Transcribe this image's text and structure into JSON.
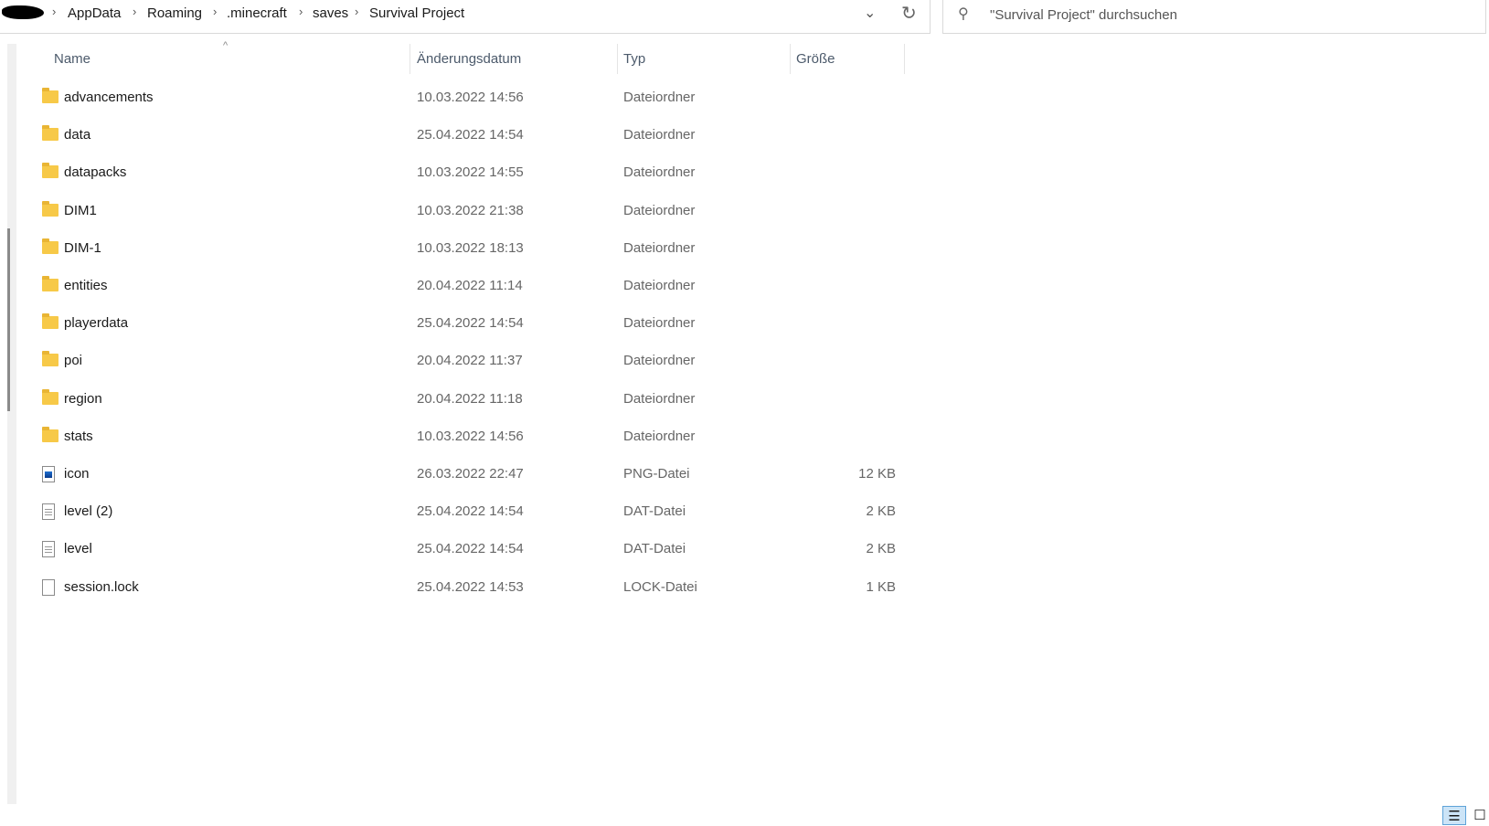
{
  "breadcrumb": [
    "AppData",
    "Roaming",
    ".minecraft",
    "saves",
    "Survival Project"
  ],
  "search": {
    "placeholder": "\"Survival Project\" durchsuchen"
  },
  "columns": {
    "name": "Name",
    "date": "Änderungsdatum",
    "type": "Typ",
    "size": "Größe"
  },
  "rows": [
    {
      "name": "advancements",
      "date": "10.03.2022 14:56",
      "type": "Dateiordner",
      "size": "",
      "icon": "folder-icon"
    },
    {
      "name": "data",
      "date": "25.04.2022 14:54",
      "type": "Dateiordner",
      "size": "",
      "icon": "folder-icon"
    },
    {
      "name": "datapacks",
      "date": "10.03.2022 14:55",
      "type": "Dateiordner",
      "size": "",
      "icon": "folder-icon"
    },
    {
      "name": "DIM1",
      "date": "10.03.2022 21:38",
      "type": "Dateiordner",
      "size": "",
      "icon": "folder-icon"
    },
    {
      "name": "DIM-1",
      "date": "10.03.2022 18:13",
      "type": "Dateiordner",
      "size": "",
      "icon": "folder-icon"
    },
    {
      "name": "entities",
      "date": "20.04.2022 11:14",
      "type": "Dateiordner",
      "size": "",
      "icon": "folder-icon"
    },
    {
      "name": "playerdata",
      "date": "25.04.2022 14:54",
      "type": "Dateiordner",
      "size": "",
      "icon": "folder-icon"
    },
    {
      "name": "poi",
      "date": "20.04.2022 11:37",
      "type": "Dateiordner",
      "size": "",
      "icon": "folder-icon"
    },
    {
      "name": "region",
      "date": "20.04.2022 11:18",
      "type": "Dateiordner",
      "size": "",
      "icon": "folder-icon"
    },
    {
      "name": "stats",
      "date": "10.03.2022 14:56",
      "type": "Dateiordner",
      "size": "",
      "icon": "folder-icon"
    },
    {
      "name": "icon",
      "date": "26.03.2022 22:47",
      "type": "PNG-Datei",
      "size": "12 KB",
      "icon": "image-file-icon"
    },
    {
      "name": "level (2)",
      "date": "25.04.2022 14:54",
      "type": "DAT-Datei",
      "size": "2 KB",
      "icon": "text-file-icon"
    },
    {
      "name": "level",
      "date": "25.04.2022 14:54",
      "type": "DAT-Datei",
      "size": "2 KB",
      "icon": "text-file-icon"
    },
    {
      "name": "session.lock",
      "date": "25.04.2022 14:53",
      "type": "LOCK-Datei",
      "size": "1 KB",
      "icon": "blank-file-icon"
    }
  ]
}
